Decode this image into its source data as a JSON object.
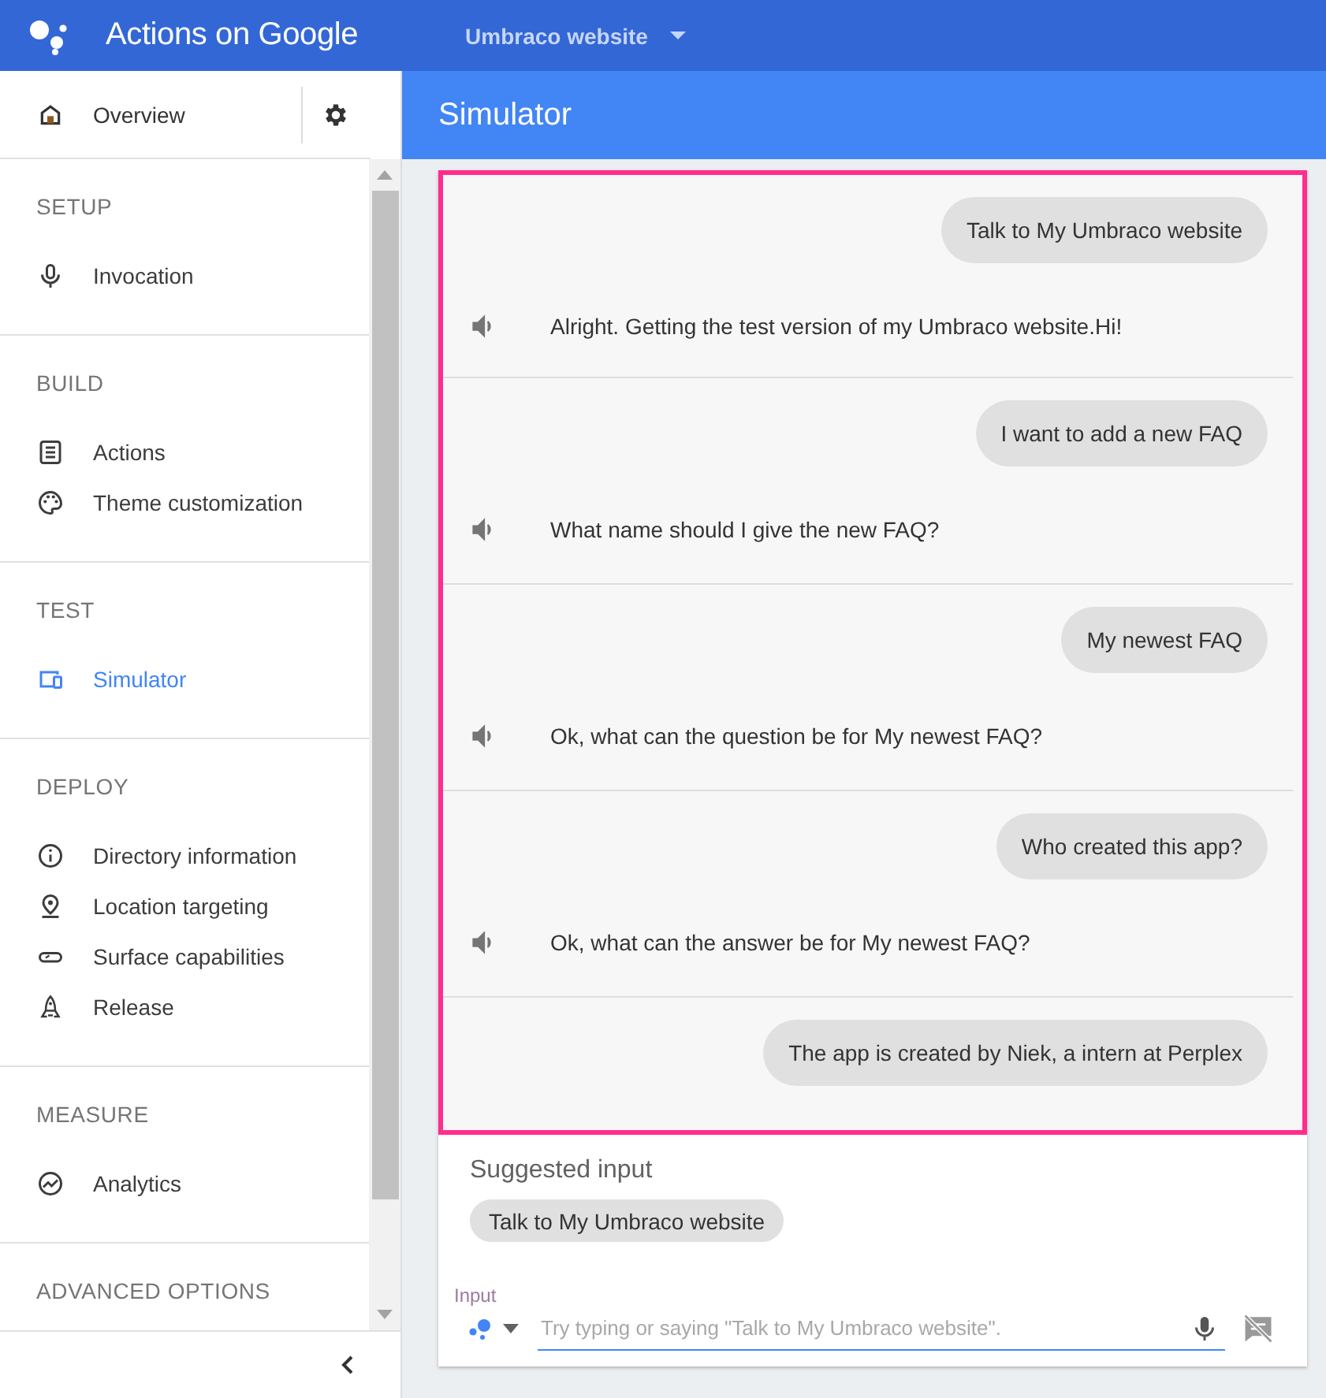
{
  "app_bar": {
    "title": "Actions on Google",
    "project": "Umbraco website"
  },
  "sidebar": {
    "overview": {
      "label": "Overview",
      "selected": false
    },
    "sections": [
      {
        "heading": "SETUP",
        "items": [
          {
            "label": "Invocation",
            "selected": false
          }
        ]
      },
      {
        "heading": "BUILD",
        "items": [
          {
            "label": "Actions",
            "selected": false
          },
          {
            "label": "Theme customization",
            "selected": false
          }
        ]
      },
      {
        "heading": "TEST",
        "items": [
          {
            "label": "Simulator",
            "selected": true
          }
        ]
      },
      {
        "heading": "DEPLOY",
        "items": [
          {
            "label": "Directory information",
            "selected": false
          },
          {
            "label": "Location targeting",
            "selected": false
          },
          {
            "label": "Surface capabilities",
            "selected": false
          },
          {
            "label": "Release",
            "selected": false
          }
        ]
      },
      {
        "heading": "MEASURE",
        "items": [
          {
            "label": "Analytics",
            "selected": false
          }
        ]
      },
      {
        "heading": "ADVANCED OPTIONS"
      }
    ]
  },
  "page": {
    "title": "Simulator"
  },
  "conversation": [
    {
      "user": "Talk to My Umbraco website",
      "reply": "Alright. Getting the test version of my Umbraco website.Hi!"
    },
    {
      "user": "I want to add a new FAQ",
      "reply": "What name should I give the new FAQ?"
    },
    {
      "user": "My newest FAQ",
      "reply": "Ok, what can the question be for My newest FAQ?"
    },
    {
      "user": "Who created this app?",
      "reply": "Ok, what can the answer be for My newest FAQ?"
    },
    {
      "user": "The app is created by Niek, a intern at Perplex"
    }
  ],
  "suggested": {
    "heading": "Suggested input",
    "chips": [
      "Talk to My Umbraco website"
    ]
  },
  "input": {
    "label": "Input",
    "placeholder": "Try typing or saying \"Talk to My Umbraco website\"."
  }
}
